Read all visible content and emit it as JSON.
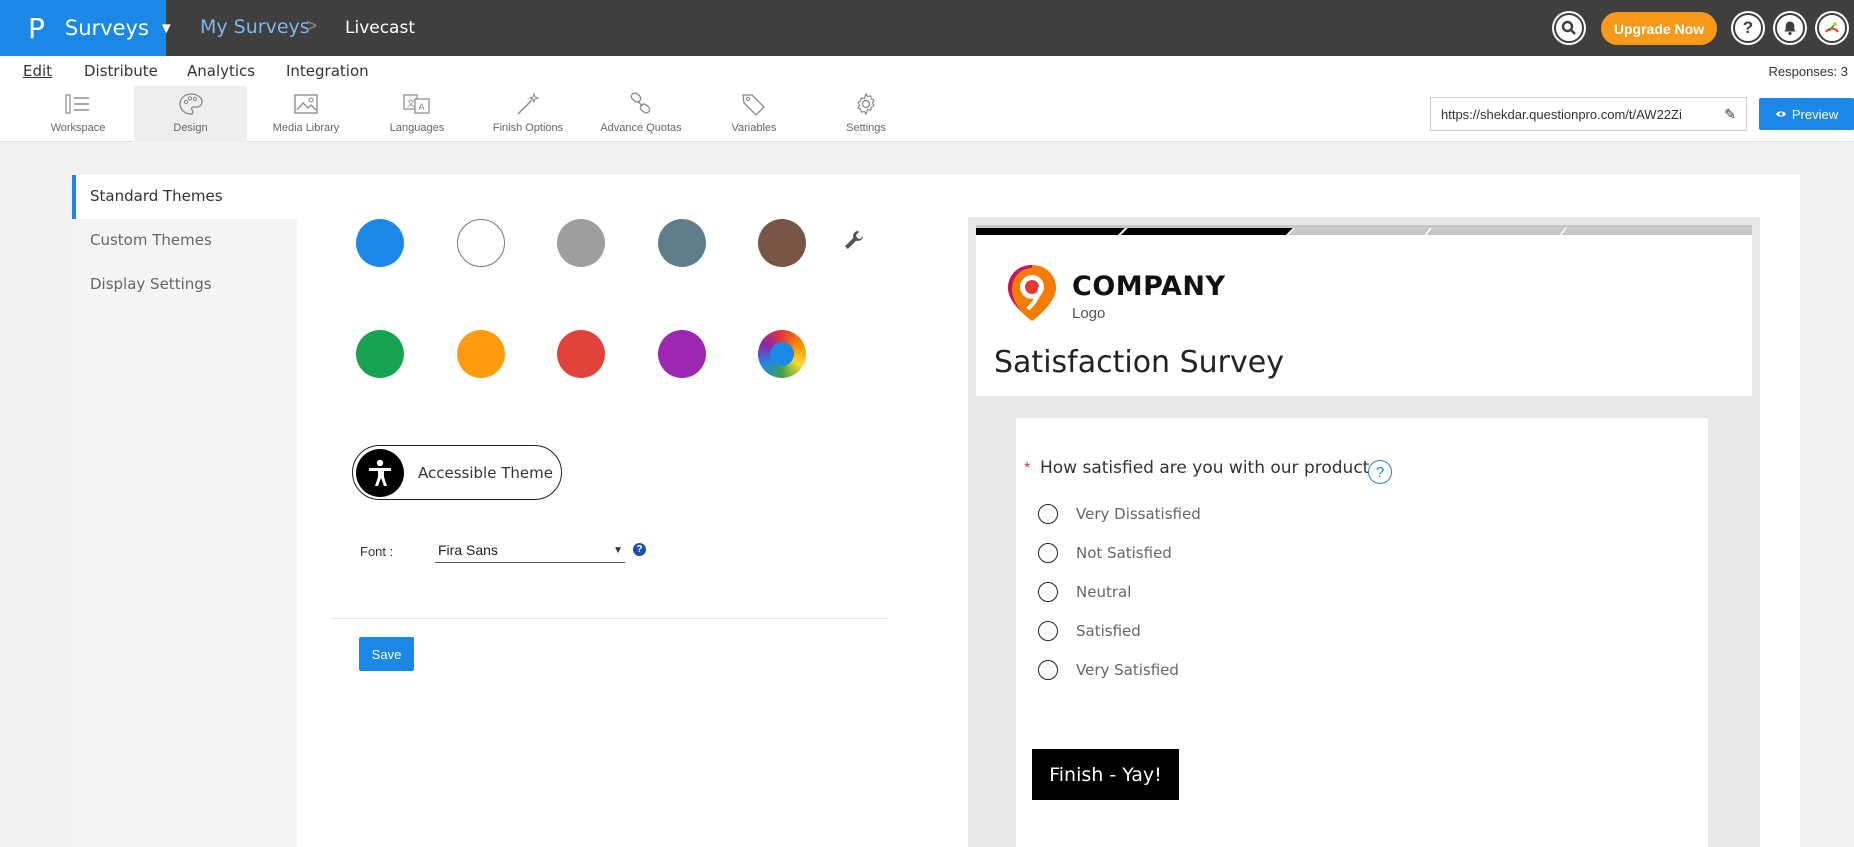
{
  "topbar": {
    "brand_logo": "P",
    "brand_name": "Surveys",
    "breadcrumb_root": "My Surveys",
    "breadcrumb_sep": ">",
    "breadcrumb_current": "Livecast",
    "upgrade_label": "Upgrade Now",
    "accent": "#1b87e6",
    "upgrade_color": "#f79a1a"
  },
  "menu": {
    "items": [
      "Edit",
      "Distribute",
      "Analytics",
      "Integration"
    ],
    "responses": "Responses: 3"
  },
  "toolbar": {
    "tools": [
      "Workspace",
      "Design",
      "Media Library",
      "Languages",
      "Finish Options",
      "Advance Quotas",
      "Variables",
      "Settings"
    ],
    "url": "https://shekdar.questionpro.com/t/AW22Zi",
    "preview_label": "Preview"
  },
  "sidenav": {
    "items": [
      "Standard Themes",
      "Custom Themes",
      "Display Settings"
    ]
  },
  "themes": {
    "colors": [
      "#1b87e6",
      "#ffffff",
      "#9e9e9e",
      "#607d8b",
      "#795548",
      "#17a352",
      "#ff9b0f",
      "#e0433a",
      "#9c27b0"
    ],
    "accessible_label": "Accessible Theme",
    "font_label": "Font :",
    "font_value": "Fira Sans",
    "save_label": "Save"
  },
  "preview": {
    "logo_company": "COMPANY",
    "logo_sub": "Logo",
    "title": "Satisfaction Survey",
    "question": "How satisfied are you with our product",
    "required_mark": "*",
    "options": [
      "Very Dissatisfied",
      "Not Satisfied",
      "Neutral",
      "Satisfied",
      "Very Satisfied"
    ],
    "finish_label": "Finish - Yay!"
  }
}
